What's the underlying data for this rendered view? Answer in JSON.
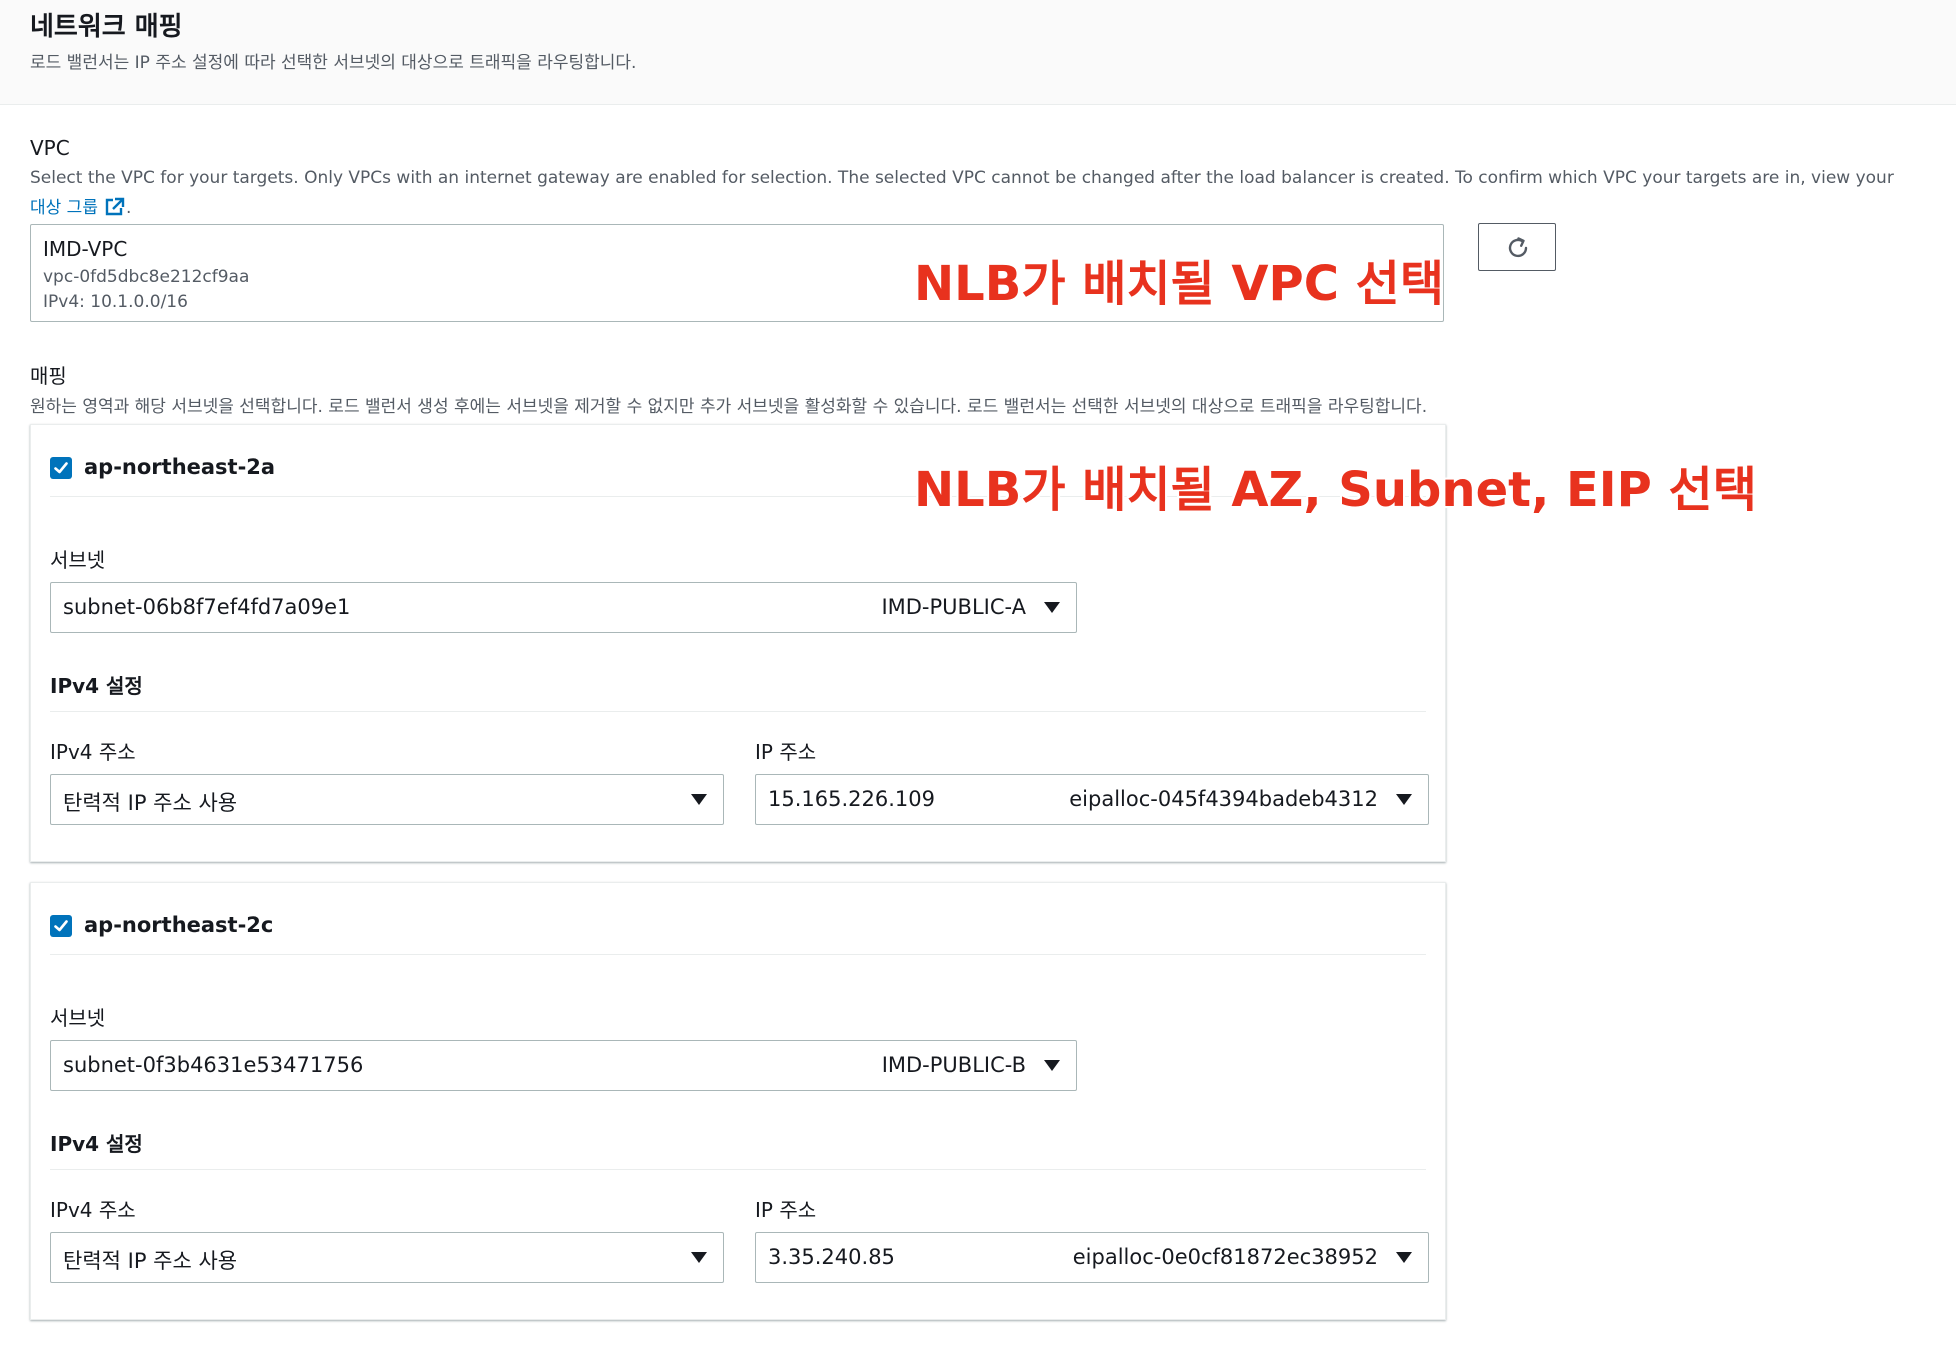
{
  "header": {
    "title": "네트워크 매핑",
    "description": "로드 밸런서는 IP 주소 설정에 따라 선택한 서브넷의 대상으로 트래픽을 라우팅합니다."
  },
  "vpc": {
    "label": "VPC",
    "description": "Select the VPC for your targets. Only VPCs with an internet gateway are enabled for selection. The selected VPC cannot be changed after the load balancer is created. To confirm which VPC your targets are in, view your",
    "link_text": "대상 그룹",
    "link_suffix": ".",
    "selected_name": "IMD-VPC",
    "selected_id": "vpc-0fd5dbc8e212cf9aa",
    "selected_cidr": "IPv4: 10.1.0.0/16",
    "refresh_icon": "refresh-icon"
  },
  "mapping": {
    "label": "매핑",
    "description": "원하는 영역과 해당 서브넷을 선택합니다. 로드 밸런서 생성 후에는 서브넷을 제거할 수 없지만 추가 서브넷을 활성화할 수 있습니다. 로드 밸런서는 선택한 서브넷의 대상으로 트래픽을 라우팅합니다.",
    "zones": [
      {
        "name": "ap-northeast-2a",
        "checked": true,
        "subnet_label": "서브넷",
        "subnet_id": "subnet-06b8f7ef4fd7a09e1",
        "subnet_name": "IMD-PUBLIC-A",
        "ipv4_heading": "IPv4 설정",
        "ipv4_addr_label": "IPv4 주소",
        "ipv4_addr_value": "탄력적 IP 주소 사용",
        "ip_label": "IP 주소",
        "ip_value": "15.165.226.109",
        "eip_alloc": "eipalloc-045f4394badeb4312"
      },
      {
        "name": "ap-northeast-2c",
        "checked": true,
        "subnet_label": "서브넷",
        "subnet_id": "subnet-0f3b4631e53471756",
        "subnet_name": "IMD-PUBLIC-B",
        "ipv4_heading": "IPv4 설정",
        "ipv4_addr_label": "IPv4 주소",
        "ipv4_addr_value": "탄력적 IP 주소 사용",
        "ip_label": "IP 주소",
        "ip_value": "3.35.240.85",
        "eip_alloc": "eipalloc-0e0cf81872ec38952"
      }
    ]
  },
  "annotations": {
    "vpc_note": "NLB가 배치될 VPC 선택",
    "az_note": "NLB가 배치될 AZ, Subnet, EIP 선택"
  },
  "colors": {
    "link": "#0073bb",
    "annotation": "#e8321e",
    "checkbox": "#0073bb"
  }
}
